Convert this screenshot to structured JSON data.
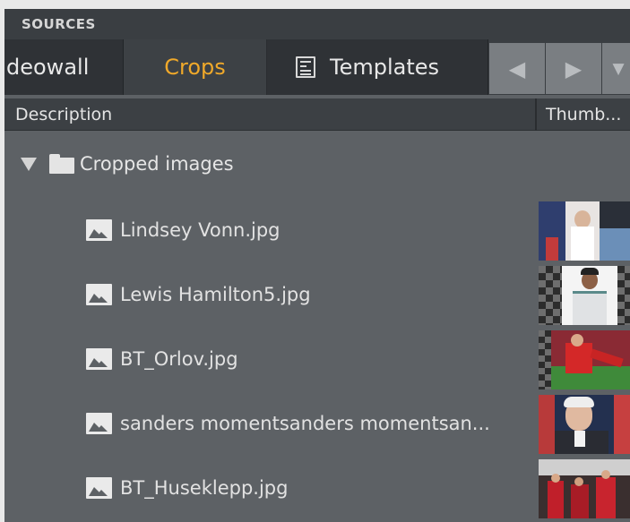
{
  "panel": {
    "title": "SOURCES"
  },
  "tabs": [
    {
      "label": "deowall",
      "active": false
    },
    {
      "label": "Crops",
      "active": true
    },
    {
      "label": "Templates",
      "active": false
    }
  ],
  "nav": {
    "prev_glyph": "◀",
    "next_glyph": "▶",
    "more_glyph": "▼"
  },
  "columns": {
    "description": "Description",
    "thumbnail": "Thumb..."
  },
  "tree": {
    "folder": {
      "label": "Cropped images",
      "icon": "folder-icon",
      "expanded": true
    },
    "items": [
      {
        "label": "Lindsey Vonn.jpg",
        "icon": "image-icon"
      },
      {
        "label": "Lewis Hamilton5.jpg",
        "icon": "image-icon"
      },
      {
        "label": "BT_Orlov.jpg",
        "icon": "image-icon"
      },
      {
        "label": "sanders momentsanders momentsan...",
        "icon": "image-icon"
      },
      {
        "label": "BT_Huseklepp.jpg",
        "icon": "image-icon"
      }
    ]
  },
  "colors": {
    "accent": "#f0a92a",
    "panel_bg": "#5d6165",
    "header_bg": "#3a3e42"
  }
}
